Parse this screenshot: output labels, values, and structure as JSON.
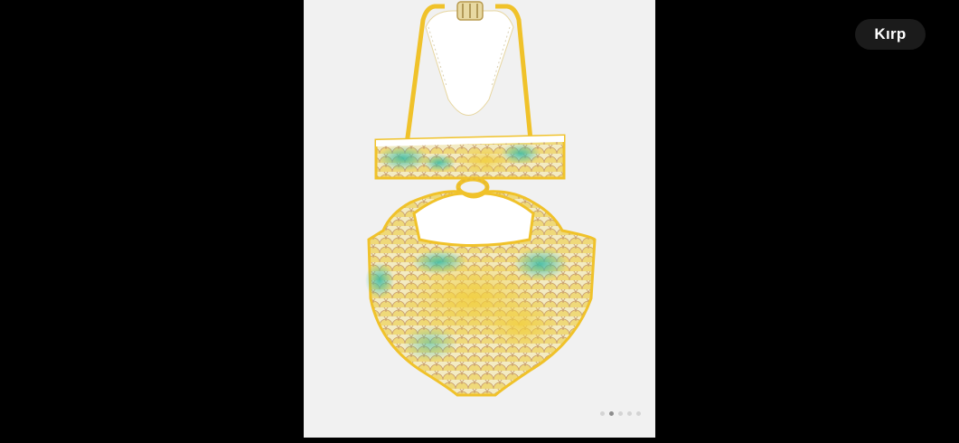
{
  "toolbar": {
    "crop_label": "Kırp"
  },
  "photo": {
    "subject": "yellow-turquoise-scale-pattern-swimsuit"
  },
  "carousel": {
    "total": 5,
    "active_index": 1
  },
  "colors": {
    "background": "#000000",
    "photo_background": "#f1f1f1",
    "swimsuit_base": "#f3ebc2",
    "scale_yellow": "#edd25c",
    "scale_turquoise": "#4cc1ad",
    "scale_lines": "#c49a6a",
    "trim_yellow": "#f0c22a"
  }
}
